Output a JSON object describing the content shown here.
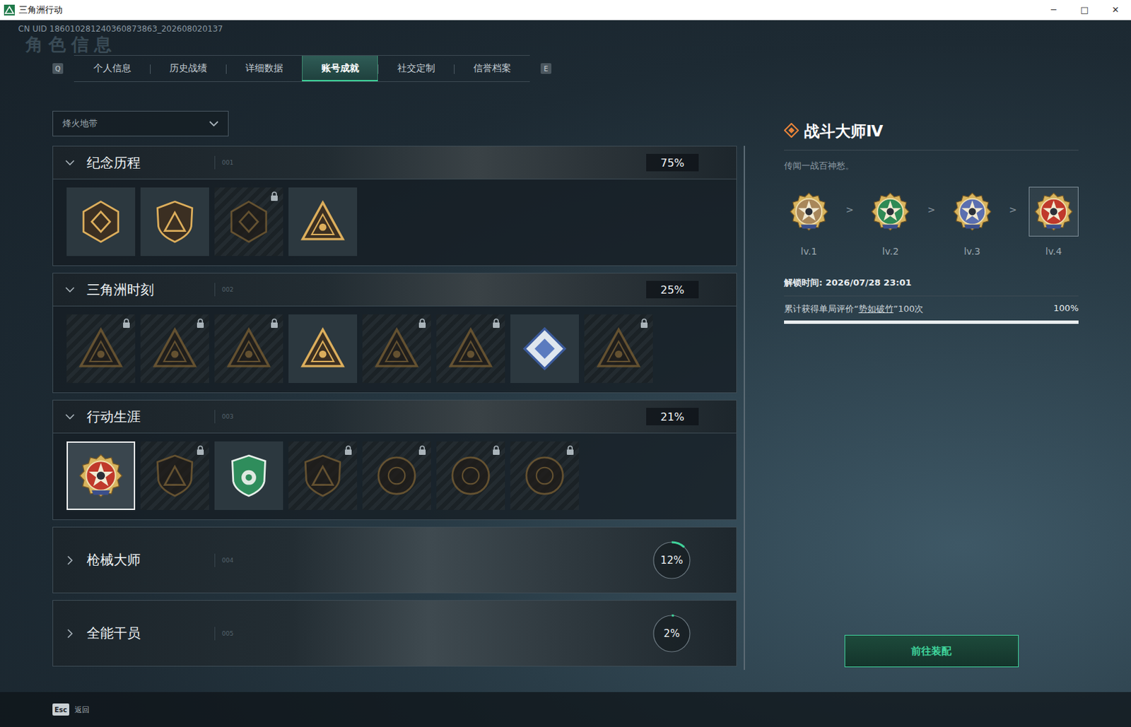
{
  "window": {
    "title": "三角洲行动",
    "controls": [
      "─",
      "□",
      "✕"
    ]
  },
  "uid": "CN UID 186010281240360873863_202608020137",
  "watermark": "角色信息",
  "tab_keys": [
    "Q",
    "E"
  ],
  "tabs": [
    {
      "label": "个人信息",
      "selected": false
    },
    {
      "label": "历史战绩",
      "selected": false
    },
    {
      "label": "详细数据",
      "selected": false
    },
    {
      "label": "账号成就",
      "selected": true
    },
    {
      "label": "社交定制",
      "selected": false
    },
    {
      "label": "信誉档案",
      "selected": false
    }
  ],
  "mode_select": {
    "value": "烽火地带"
  },
  "sections": [
    {
      "title": "纪念历程",
      "code": "001",
      "percent": "75%",
      "expanded": true,
      "badges": [
        {
          "kind": "hexagon",
          "locked": false,
          "selected": false
        },
        {
          "kind": "shield",
          "locked": false,
          "selected": false
        },
        {
          "kind": "hexagon",
          "locked": true,
          "selected": false
        },
        {
          "kind": "triangle",
          "locked": false,
          "selected": false
        }
      ]
    },
    {
      "title": "三角洲时刻",
      "code": "002",
      "percent": "25%",
      "expanded": true,
      "badges": [
        {
          "kind": "triangle",
          "locked": true,
          "selected": false
        },
        {
          "kind": "triangle",
          "locked": true,
          "selected": false
        },
        {
          "kind": "triangle",
          "locked": true,
          "selected": false
        },
        {
          "kind": "triangle",
          "locked": false,
          "selected": false
        },
        {
          "kind": "triangle",
          "locked": true,
          "selected": false
        },
        {
          "kind": "triangle",
          "locked": true,
          "selected": false
        },
        {
          "kind": "diamond",
          "locked": false,
          "selected": false
        },
        {
          "kind": "triangle",
          "locked": true,
          "selected": false
        }
      ]
    },
    {
      "title": "行动生涯",
      "code": "003",
      "percent": "21%",
      "expanded": true,
      "badges": [
        {
          "kind": "medal",
          "locked": false,
          "selected": true
        },
        {
          "kind": "shield",
          "locked": true,
          "selected": false
        },
        {
          "kind": "green-shield",
          "locked": false,
          "selected": false
        },
        {
          "kind": "shield",
          "locked": true,
          "selected": false
        },
        {
          "kind": "round",
          "locked": true,
          "selected": false
        },
        {
          "kind": "round",
          "locked": true,
          "selected": false
        },
        {
          "kind": "round",
          "locked": true,
          "selected": false
        }
      ]
    },
    {
      "title": "枪械大师",
      "code": "004",
      "percent": "12%",
      "expanded": false,
      "level": 0.12,
      "badges": []
    },
    {
      "title": "全能干员",
      "code": "005",
      "percent": "2%",
      "expanded": false,
      "level": 0.02,
      "badges": []
    }
  ],
  "detail": {
    "title": "战斗大师Ⅳ",
    "description": "传闻一战百神愁。",
    "levels": [
      {
        "label": "lv.1",
        "color": "#a8875a",
        "selected": false
      },
      {
        "label": "lv.2",
        "color": "#2f8a55",
        "selected": false
      },
      {
        "label": "lv.3",
        "color": "#5b6fb0",
        "selected": false
      },
      {
        "label": "lv.4",
        "color": "#c0392b",
        "selected": true
      }
    ],
    "separator": ">",
    "unlock": "解锁时间: 2026/07/28 23:01",
    "requirement": {
      "prefix": "累计获得单局评价“",
      "highlight": "势如破竹",
      "suffix": "”100次",
      "percent": "100%",
      "level": 1
    },
    "button": "前往装配"
  },
  "footer": {
    "key": "Esc",
    "label": "返回"
  }
}
